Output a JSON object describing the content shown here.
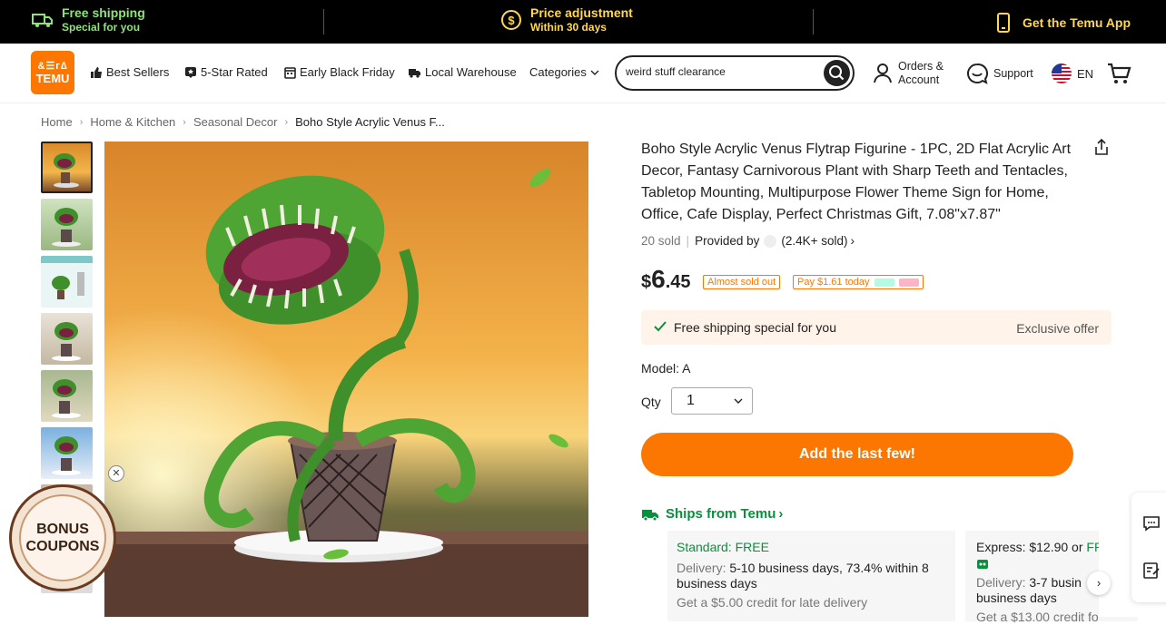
{
  "topbar": {
    "free_shipping_title": "Free shipping",
    "free_shipping_sub": "Special for you",
    "price_adj_title": "Price adjustment",
    "price_adj_sub": "Within 30 days",
    "app_label": "Get the Temu App",
    "colors": {
      "green": "#8fe37a",
      "yellow": "#ffd84d"
    }
  },
  "header": {
    "logo_top": "&☰г∆",
    "logo_text": "TEMU",
    "nav": [
      {
        "label": "Best Sellers",
        "icon": "thumbs-up-icon"
      },
      {
        "label": "5-Star Rated",
        "icon": "star-badge-icon"
      },
      {
        "label": "Early Black Friday",
        "icon": "calendar-icon"
      },
      {
        "label": "Local Warehouse",
        "icon": "truck-icon"
      },
      {
        "label": "Categories",
        "icon": "chevron-down-icon"
      }
    ],
    "search_value": "weird stuff clearance",
    "orders_line1": "Orders &",
    "orders_line2": "Account",
    "support": "Support",
    "lang": "EN",
    "brand_color": "#fb7701"
  },
  "breadcrumb": [
    "Home",
    "Home & Kitchen",
    "Seasonal Decor",
    "Boho Style Acrylic Venus F..."
  ],
  "product": {
    "title": "Boho Style Acrylic Venus Flytrap Figurine - 1PC, 2D Flat Acrylic Art Decor, Fantasy Carnivorous Plant with Sharp Teeth and Tentacles, Tabletop Mounting, Multipurpose Flower Theme Sign for Home, Office, Cafe Display, Perfect Christmas Gift, 7.08\"x7.87\"",
    "sold": "20 sold",
    "provided_by": "Provided by",
    "seller_sold": "(2.4K+ sold)",
    "price_currency": "$",
    "price_int": "6",
    "price_dec": ".45",
    "tag_almost": "Almost sold out",
    "tag_pay": "Pay $1.61 today",
    "shipping_text": "Free shipping special for you",
    "shipping_offer": "Exclusive offer",
    "model_label": "Model: A",
    "qty_label": "Qty",
    "qty_value": "1",
    "add_button": "Add the last few!",
    "ships_from": "Ships from Temu",
    "standard": {
      "title": "Standard: FREE",
      "delivery_label": "Delivery:",
      "delivery_value": "5-10 business days, 73.4% within 8 business days",
      "credit": "Get a $5.00 credit for late delivery"
    },
    "express": {
      "title_prefix": "Express: $12.90 or",
      "title_suffix": "FR",
      "delivery_label": "Delivery:",
      "delivery_value": "3-7 busin",
      "delivery_line2": "business days",
      "credit": "Get a $13.00 credit fo"
    }
  },
  "bonus": {
    "line1": "BONUS",
    "line2": "COUPONS"
  },
  "thumbnails": [
    "thumb-1",
    "thumb-2",
    "thumb-3",
    "thumb-4",
    "thumb-5",
    "thumb-6",
    "thumb-7"
  ]
}
